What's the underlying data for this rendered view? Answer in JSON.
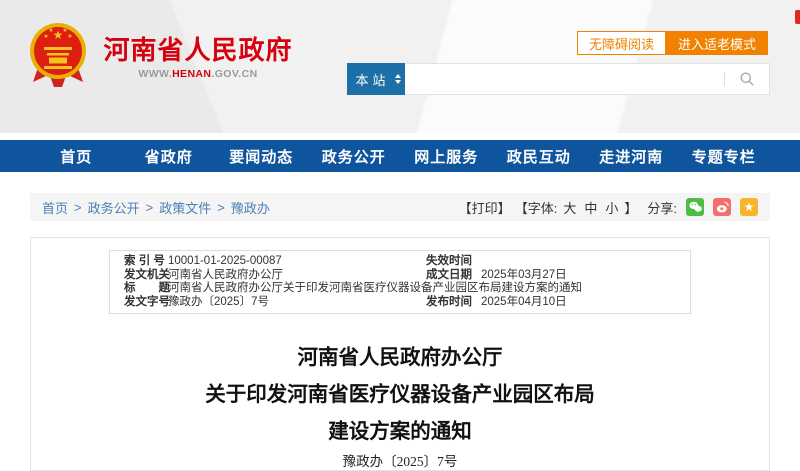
{
  "header": {
    "site_title": "河南省人民政府",
    "site_url": {
      "www": "WWW.",
      "domain": "HENAN",
      "suffix": ".GOV.CN"
    },
    "accessibility_button": "无障碍阅读",
    "elder_mode_button": "进入适老模式",
    "search": {
      "scope": "本站",
      "placeholder": ""
    }
  },
  "nav": {
    "items": [
      "首页",
      "省政府",
      "要闻动态",
      "政务公开",
      "网上服务",
      "政民互动",
      "走进河南",
      "专题专栏"
    ]
  },
  "breadcrumb": {
    "separator": ">",
    "items": [
      "首页",
      "政务公开",
      "政策文件",
      "豫政办"
    ]
  },
  "toolbar": {
    "print": "【打印】",
    "font_prefix": "【字体:",
    "font_sizes": [
      "大",
      "中",
      "小"
    ],
    "font_suffix": "】",
    "share": "分享:",
    "share_icons": [
      "wechat",
      "weibo",
      "favorite"
    ]
  },
  "meta_table": {
    "rows": [
      {
        "label1": "索 引 号",
        "value1": "10001-01-2025-00087",
        "label2": "失效时间",
        "value2": ""
      },
      {
        "label1": "发文机关",
        "value1": "河南省人民政府办公厅",
        "label2": "成文日期",
        "value2": "2025年03月27日"
      },
      {
        "label1": "标　　题",
        "value1": "河南省人民政府办公厅关于印发河南省医疗仪器设备产业园区布局建设方案的通知",
        "label2": "",
        "value2": ""
      },
      {
        "label1": "发文字号",
        "value1": "豫政办〔2025〕7号",
        "label2": "发布时间",
        "value2": "2025年04月10日"
      }
    ]
  },
  "document": {
    "title_lines": [
      "河南省人民政府办公厅",
      "关于印发河南省医疗仪器设备产业园区布局",
      "建设方案的通知"
    ],
    "doc_number": "豫政办〔2025〕7号"
  },
  "colors": {
    "brand_red": "#d7000f",
    "nav_blue": "#0f559d",
    "search_blue": "#1d6fa8",
    "accent_orange": "#f08200",
    "breadcrumb_blue": "#4b7fb7",
    "wechat_green": "#4dbe43",
    "weibo_red": "#f56e6e",
    "star_yellow": "#f7b52c"
  }
}
